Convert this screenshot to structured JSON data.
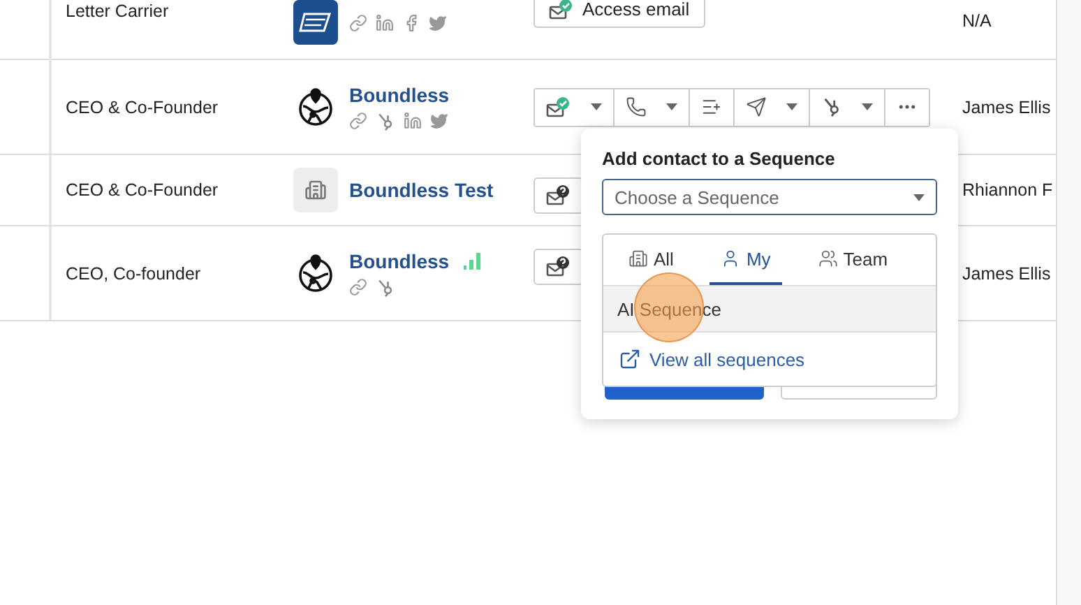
{
  "rows": [
    {
      "title": "Letter Carrier",
      "company": {
        "logo": {
          "kind": "postal"
        },
        "links": [
          {
            "kind": "link"
          },
          {
            "kind": "linkedin"
          },
          {
            "kind": "facebook"
          },
          {
            "kind": "twitter"
          }
        ],
        "intent": false
      },
      "action": {
        "kind": "access",
        "label": "Access email",
        "verified": true
      },
      "owner": "N/A"
    },
    {
      "title": "CEO & Co-Founder",
      "company": {
        "name": "Boundless",
        "logo": {
          "kind": "globe"
        },
        "links": [
          {
            "kind": "link"
          },
          {
            "kind": "hubspot"
          },
          {
            "kind": "linkedin"
          },
          {
            "kind": "twitter"
          }
        ],
        "intent": false
      },
      "action": {
        "kind": "toolbar",
        "tools": [
          {
            "dropdown": true
          },
          {
            "dropdown": true
          },
          {
            "dropdown": false
          },
          {
            "dropdown": true
          },
          {
            "dropdown": true
          },
          {
            "dropdown": false
          }
        ]
      },
      "owner": "James Ellis"
    },
    {
      "title": "CEO & Co-Founder",
      "company": {
        "name": "Boundless Test",
        "logo": {
          "kind": "building"
        },
        "intent": false
      },
      "action": {
        "kind": "email",
        "verified": false
      },
      "owner": "Rhiannon F"
    },
    {
      "title": "CEO, Co-founder",
      "company": {
        "name": "Boundless",
        "logo": {
          "kind": "globe"
        },
        "links": [
          {
            "kind": "link"
          },
          {
            "kind": "hubspot"
          }
        ],
        "intent": true
      },
      "action": {
        "kind": "email",
        "verified": false
      },
      "owner": "James Ellis"
    }
  ],
  "popover": {
    "title": "Add contact to a Sequence",
    "select": {
      "placeholder": "Choose a Sequence"
    },
    "tabs": [
      {
        "label": "All",
        "selected": false
      },
      {
        "label": "My",
        "selected": true
      },
      {
        "label": "Team",
        "selected": false
      }
    ],
    "items": [
      {
        "label": "AI Sequence",
        "hovered": true
      }
    ],
    "link": "View all sequences"
  }
}
